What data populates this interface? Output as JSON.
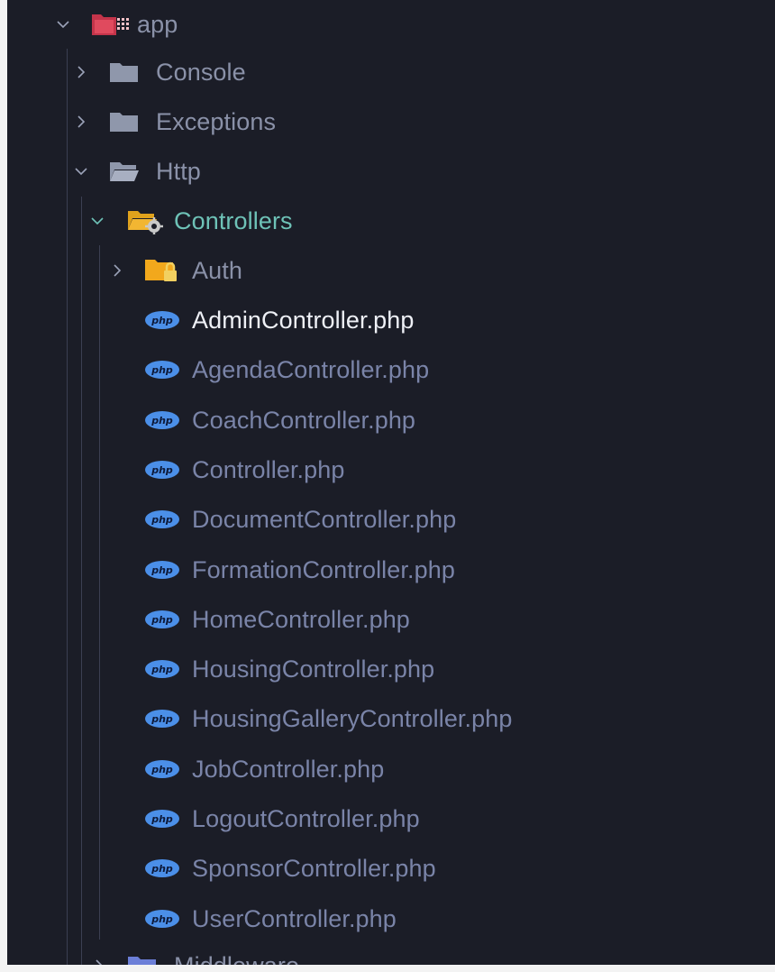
{
  "explorer": {
    "app": {
      "label": "app",
      "icon": "app-folder-icon",
      "expanded": true
    },
    "console": {
      "label": "Console",
      "icon": "folder-icon",
      "expanded": false
    },
    "exceptions": {
      "label": "Exceptions",
      "icon": "folder-icon",
      "expanded": false
    },
    "http": {
      "label": "Http",
      "icon": "folder-open-icon",
      "expanded": true
    },
    "controllers": {
      "label": "Controllers",
      "icon": "controllers-folder-icon",
      "expanded": true
    },
    "auth": {
      "label": "Auth",
      "icon": "auth-folder-icon",
      "expanded": false
    },
    "files": [
      {
        "label": "AdminController.php",
        "active": true
      },
      {
        "label": "AgendaController.php"
      },
      {
        "label": "CoachController.php"
      },
      {
        "label": "Controller.php"
      },
      {
        "label": "DocumentController.php"
      },
      {
        "label": "FormationController.php"
      },
      {
        "label": "HomeController.php"
      },
      {
        "label": "HousingController.php"
      },
      {
        "label": "HousingGalleryController.php"
      },
      {
        "label": "JobController.php"
      },
      {
        "label": "LogoutController.php"
      },
      {
        "label": "SponsorController.php"
      },
      {
        "label": "UserController.php"
      }
    ],
    "middleware": {
      "label": "Middleware",
      "icon": "middleware-folder-icon",
      "expanded": false
    },
    "php_icon_text": "php"
  },
  "colors": {
    "background": "#1b1d27",
    "text": "#8a91a8",
    "active_text": "#eef0f6",
    "controllers_text": "#6ec2b7",
    "php_icon": "#4b8fe8"
  }
}
